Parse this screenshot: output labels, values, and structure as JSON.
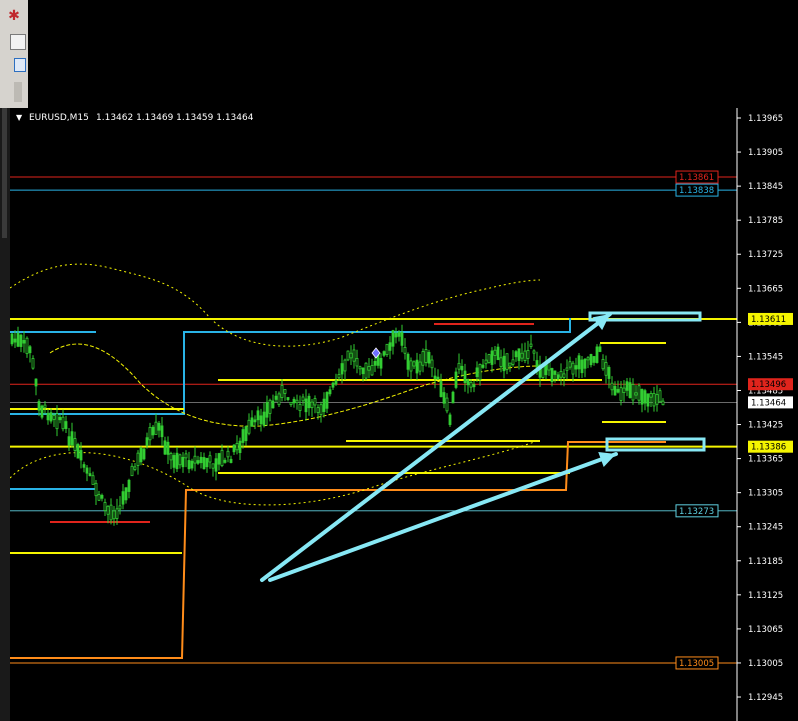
{
  "symbol": "EURUSD,M15",
  "ohlc_text": "1.13462 1.13469 1.13459 1.13464",
  "icons": {
    "app": "metatrader-logo-icon",
    "menu": "dropdown-triangle-icon"
  },
  "chart_data": {
    "type": "candlestick",
    "y_axis_ticks": [
      "1.13965",
      "1.13905",
      "1.13845",
      "1.13785",
      "1.13725",
      "1.13665",
      "1.13605",
      "1.13545",
      "1.13485",
      "1.13425",
      "1.13365",
      "1.13305",
      "1.13245",
      "1.13185",
      "1.13125",
      "1.13065",
      "1.13005",
      "1.12945"
    ],
    "ylim": [
      1.12925,
      1.13985
    ],
    "current_price": 1.13464,
    "price_labels": [
      {
        "text": "1.13861",
        "value": 1.13861,
        "color": "#e0241c"
      },
      {
        "text": "1.13838",
        "value": 1.13838,
        "color": "#29b3e6"
      },
      {
        "text": "1.13611",
        "value": 1.13611,
        "color": "#f5f500"
      },
      {
        "text": "1.13496",
        "value": 1.13496,
        "color": "#e0241c"
      },
      {
        "text": "1.13464",
        "value": 1.13464,
        "color": "#ffffff"
      },
      {
        "text": "1.13386",
        "value": 1.13386,
        "color": "#f5f500"
      },
      {
        "text": "1.13273",
        "value": 1.13273,
        "color": "#5fd0e0"
      },
      {
        "text": "1.13005",
        "value": 1.13005,
        "color": "#ff8c1a"
      }
    ],
    "grid": false,
    "colors": {
      "bull": "#32cd32",
      "bear": "#32cd32",
      "bg": "#000000",
      "arrows": "#87e8f5",
      "band": "#f5f500"
    }
  }
}
